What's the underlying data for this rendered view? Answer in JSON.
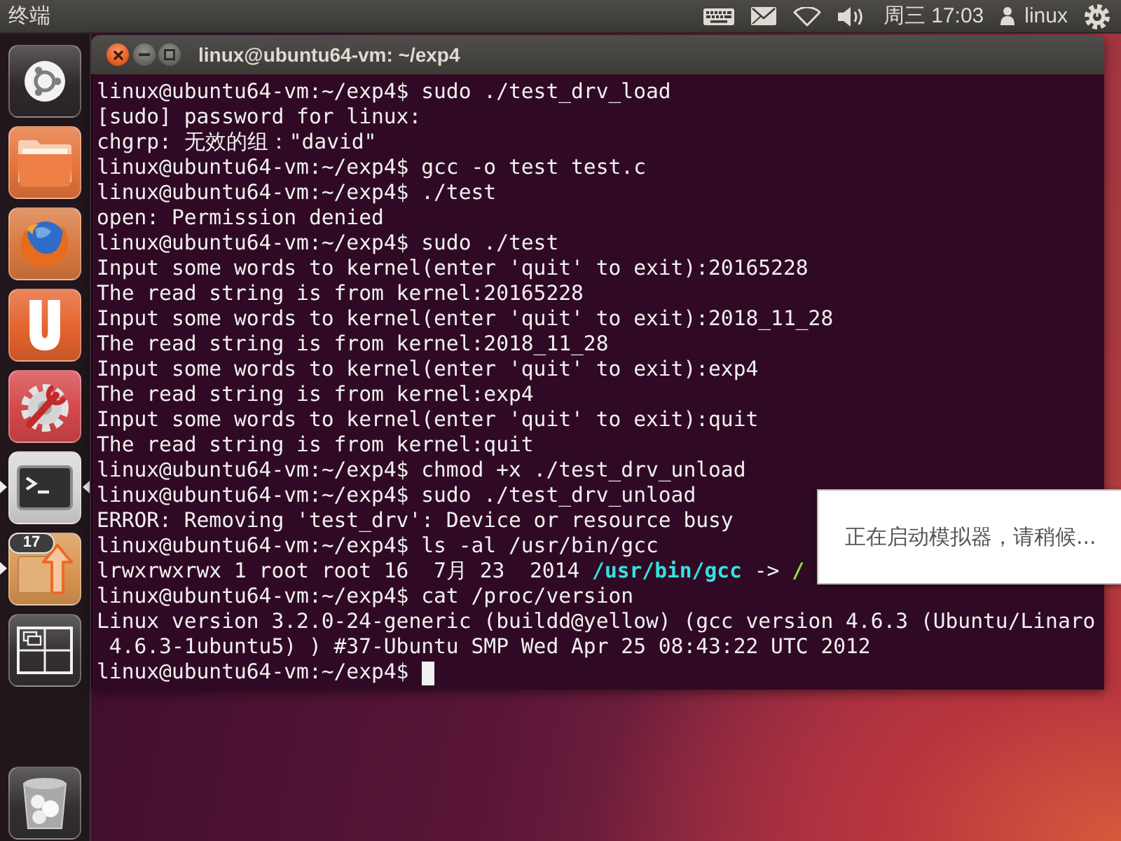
{
  "panel": {
    "app_title": "终端",
    "clock": "周三 17:03",
    "user": "linux"
  },
  "launcher": {
    "items": [
      {
        "kind": "dash",
        "running": false,
        "focused": false
      },
      {
        "kind": "files",
        "running": false,
        "focused": false
      },
      {
        "kind": "browser",
        "running": false,
        "focused": false
      },
      {
        "kind": "u-app",
        "running": false,
        "focused": false
      },
      {
        "kind": "settings",
        "running": false,
        "focused": false
      },
      {
        "kind": "terminal",
        "running": true,
        "focused": true
      },
      {
        "kind": "updates",
        "running": true,
        "focused": false,
        "badge": "17"
      },
      {
        "kind": "workspaces",
        "running": false,
        "focused": false
      }
    ],
    "bottom_items": [
      {
        "kind": "trash",
        "running": false,
        "focused": false
      }
    ]
  },
  "terminal": {
    "title": "linux@ubuntu64-vm: ~/exp4",
    "lines": [
      {
        "text": "linux@ubuntu64-vm:~/exp4$ sudo ./test_drv_load"
      },
      {
        "text": "[sudo] password for linux:"
      },
      {
        "text": "chgrp: 无效的组：\"david\""
      },
      {
        "text": "linux@ubuntu64-vm:~/exp4$ gcc -o test test.c"
      },
      {
        "text": "linux@ubuntu64-vm:~/exp4$ ./test"
      },
      {
        "text": "open: Permission denied"
      },
      {
        "text": "linux@ubuntu64-vm:~/exp4$ sudo ./test"
      },
      {
        "text": "Input some words to kernel(enter 'quit' to exit):20165228"
      },
      {
        "text": "The read string is from kernel:20165228"
      },
      {
        "text": "Input some words to kernel(enter 'quit' to exit):2018_11_28"
      },
      {
        "text": "The read string is from kernel:2018_11_28"
      },
      {
        "text": "Input some words to kernel(enter 'quit' to exit):exp4"
      },
      {
        "text": "The read string is from kernel:exp4"
      },
      {
        "text": "Input some words to kernel(enter 'quit' to exit):quit"
      },
      {
        "text": "The read string is from kernel:quit"
      },
      {
        "text": "linux@ubuntu64-vm:~/exp4$ chmod +x ./test_drv_unload"
      },
      {
        "text": "linux@ubuntu64-vm:~/exp4$ sudo ./test_drv_unload"
      },
      {
        "text": "ERROR: Removing 'test_drv': Device or resource busy"
      },
      {
        "text": "linux@ubuntu64-vm:~/exp4$ ls -al /usr/bin/gcc"
      },
      {
        "segments": [
          {
            "kind": "plain",
            "text": "lrwxrwxrwx 1 root root 16  7月 23  2014 "
          },
          {
            "kind": "symlink",
            "text": "/usr/bin/gcc"
          },
          {
            "kind": "plain",
            "text": " -> "
          },
          {
            "kind": "executable",
            "text": "/"
          }
        ]
      },
      {
        "text": "linux@ubuntu64-vm:~/exp4$ cat /proc/version"
      },
      {
        "text": "Linux version 3.2.0-24-generic (buildd@yellow) (gcc version 4.6.3 (Ubuntu/Linaro"
      },
      {
        "text": " 4.6.3-1ubuntu5) ) #37-Ubuntu SMP Wed Apr 25 08:43:22 UTC 2012"
      },
      {
        "text": "linux@ubuntu64-vm:~/exp4$"
      }
    ],
    "cursor": true
  },
  "notification": {
    "text": "正在启动模拟器，请稍候..."
  }
}
